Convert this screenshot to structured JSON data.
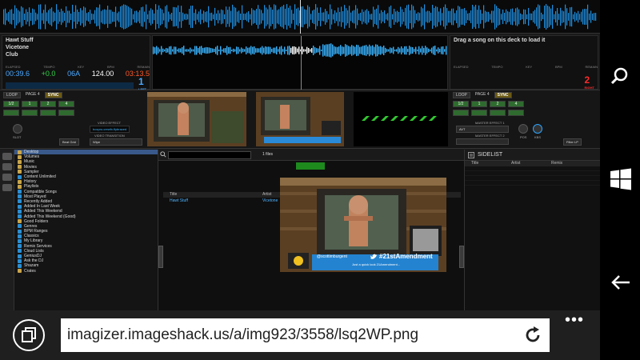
{
  "deck_left": {
    "title": "Hawt Stuff",
    "artist": "Vicetone",
    "album": "Club",
    "labels": [
      "ELAPSED",
      "TEMPO",
      "KEY",
      "BPM",
      "REMAIN"
    ],
    "elapsed": "00:39.6",
    "tempo": "+0.0",
    "key": "06A",
    "bpm": "124.00",
    "remain": "03:13.5",
    "deck_number": "1",
    "deck_side": "LEFT",
    "colors": {
      "elapsed": "#4aa8ff",
      "tempo": "#35d04a",
      "key": "#4aa8ff",
      "bpm": "#ffffff",
      "remain": "#ff5a2a",
      "deck_number": "#4aa8ff"
    }
  },
  "deck_right": {
    "prompt": "Drag a song on this deck to load it",
    "labels": [
      "ELAPSED",
      "TEMPO",
      "KEY",
      "BPM",
      "REMAIN"
    ],
    "deck_number": "2",
    "deck_side": "RIGHT",
    "deck_number_color": "#ff2b2b"
  },
  "controls_left": {
    "loop_label": "LOOP",
    "page_label": "PAGE 4",
    "sync_label": "SYNC",
    "loop_buttons": [
      "1/2",
      "1",
      "2",
      "4"
    ],
    "video_effect_label": "VIDEO EFFECT",
    "video_effect_value": "boxpro.crewfx.flybraced",
    "video_transition_label": "VIDEO TRANSITION",
    "video_transition_value": "Wipe",
    "beat_grid_label": "Beat Grid",
    "slot_label": "SLOT"
  },
  "controls_right": {
    "loop_label": "LOOP",
    "page_label": "PAGE 4",
    "sync_label": "SYNC",
    "loop_buttons": [
      "1/2",
      "1",
      "2",
      "4"
    ],
    "master_effect_1_label": "MASTER EFFECT 1",
    "master_effect_1_value": "AVT",
    "master_effect_2_label": "MASTER EFFECT 2",
    "pos_label": "POS",
    "kbs_label": "KBS",
    "filter_label": "Filter LP"
  },
  "browser": {
    "files_count": "1 files",
    "columns": [
      "Title",
      "Artist"
    ],
    "track": {
      "title": "Hawt Stuff",
      "artist": "Vicetone"
    },
    "tree": [
      {
        "label": "Desktop",
        "selected": true,
        "kind": "folder"
      },
      {
        "label": "Volumes",
        "kind": "folder"
      },
      {
        "label": "Music",
        "kind": "folder"
      },
      {
        "label": "Movies",
        "kind": "folder"
      },
      {
        "label": "Sampler",
        "kind": "folder"
      },
      {
        "label": "Content Unlimited",
        "kind": "item"
      },
      {
        "label": "History",
        "kind": "folder"
      },
      {
        "label": "Playlists",
        "kind": "folder"
      },
      {
        "label": "Compatible Songs",
        "kind": "item"
      },
      {
        "label": "Most Played",
        "kind": "item"
      },
      {
        "label": "Recently Added",
        "kind": "item"
      },
      {
        "label": "Added In Last Week",
        "kind": "item"
      },
      {
        "label": "Added This Weekend",
        "kind": "item"
      },
      {
        "label": "Added This Weekend (Good)",
        "kind": "item"
      },
      {
        "label": "Good Folders",
        "kind": "folder"
      },
      {
        "label": "Genres",
        "kind": "item"
      },
      {
        "label": "BPM Ranges",
        "kind": "item"
      },
      {
        "label": "Classics",
        "kind": "item"
      },
      {
        "label": "My Library",
        "kind": "item"
      },
      {
        "label": "Remix Services",
        "kind": "item"
      },
      {
        "label": "Cloud Lists",
        "kind": "item"
      },
      {
        "label": "GeniusDJ",
        "kind": "item"
      },
      {
        "label": "Ask the DJ",
        "kind": "item"
      },
      {
        "label": "Shazam",
        "kind": "item"
      },
      {
        "label": "Crates",
        "kind": "folder"
      }
    ],
    "video_overlay": {
      "handle": "@scottimburgent",
      "hashtag": "#21stAmendment",
      "caption": "Just a quick look 21Amendment..."
    }
  },
  "sidelist": {
    "title": "SIDELIST",
    "columns": [
      "Title",
      "Artist",
      "Remix"
    ]
  },
  "address_bar": {
    "url": "imagizer.imageshack.us/a/img923/3558/lsq2WP.png"
  },
  "system_icons": [
    "search-icon",
    "windows-logo-icon",
    "back-arrow-icon"
  ]
}
